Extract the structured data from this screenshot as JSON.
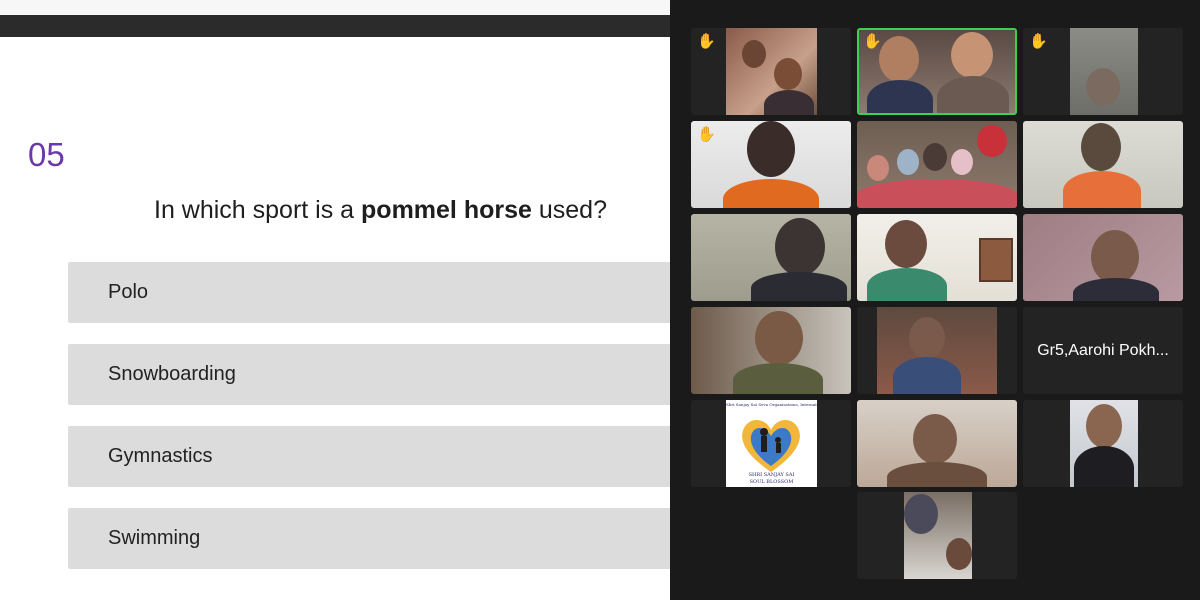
{
  "quiz": {
    "number": "05",
    "question_prefix": "In which sport is a ",
    "question_bold": "pommel horse",
    "question_suffix": " used?",
    "options": [
      "Polo",
      "Snowboarding",
      "Gymnastics",
      "Swimming"
    ]
  },
  "gallery": {
    "name_tile": "Gr5,Aarohi Pokh...",
    "logo": {
      "arc_text": "Shri Sanjay Sai Seva Organisations, International",
      "line1": "SHRI SANJAY SAI",
      "line2": "SOUL BLOSSOM"
    },
    "active_speaker_color": "#3bd24e",
    "raise_hand_icon": "raised-hand-icon"
  }
}
